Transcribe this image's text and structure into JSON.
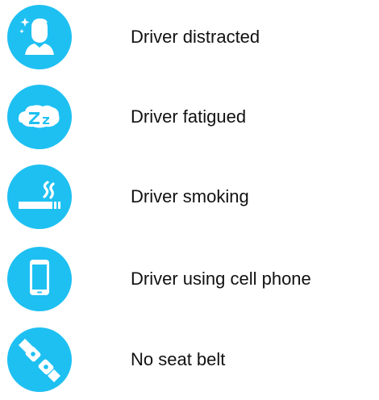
{
  "accent_color": "#1ec0f2",
  "items": [
    {
      "label": "Driver distracted",
      "icon": "distracted-driver-icon"
    },
    {
      "label": "Driver fatigued",
      "icon": "sleep-zz-icon"
    },
    {
      "label": "Driver smoking",
      "icon": "cigarette-icon"
    },
    {
      "label": "Driver using cell phone",
      "icon": "cell-phone-icon"
    },
    {
      "label": "No seat belt",
      "icon": "seat-belt-icon"
    }
  ]
}
